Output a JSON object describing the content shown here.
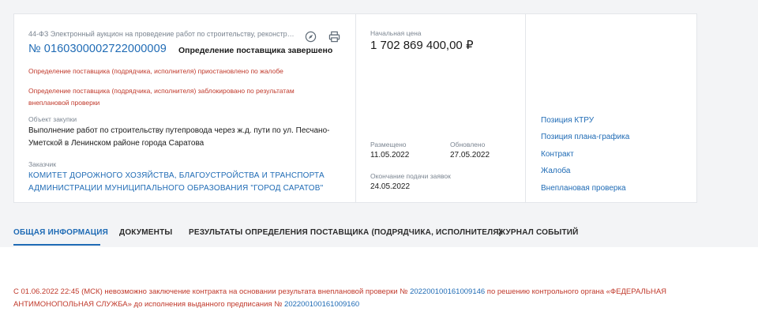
{
  "header": {
    "law_line": "44-ФЗ Электронный аукцион на проведение работ по строительству, реконструкц...",
    "reg_number": "№ 0160300002722000009",
    "stage": "Определение поставщика завершено",
    "alert_1": "Определение поставщика (подрядчика, исполнителя) приостановлено по жалобе",
    "alert_2": "Определение поставщика (подрядчика, исполнителя) заблокировано по результатам внеплановой проверки",
    "object_label": "Объект закупки",
    "object_value": "Выполнение работ по строительству путепровода через ж.д. пути по ул. Песчано-Уметской в Ленинском районе города Саратова",
    "customer_label": "Заказчик",
    "customer_value": "КОМИТЕТ ДОРОЖНОГО ХОЗЯЙСТВА, БЛАГОУСТРОЙСТВА И ТРАНСПОРТА АДМИНИСТРАЦИИ МУНИЦИПАЛЬНОГО ОБРАЗОВАНИЯ \"ГОРОД САРАТОВ\"",
    "icons": [
      "compass-icon",
      "printer-icon"
    ]
  },
  "price": {
    "label": "Начальная цена",
    "value": "1 702 869 400,00 ₽"
  },
  "dates": {
    "posted_label": "Размещено",
    "posted_value": "11.05.2022",
    "updated_label": "Обновлено",
    "updated_value": "27.05.2022",
    "deadline_label": "Окончание подачи заявок",
    "deadline_value": "24.05.2022"
  },
  "side_links": [
    "Позиция КТРУ",
    "Позиция плана-графика",
    "Контракт",
    "Жалоба",
    "Внеплановая проверка"
  ],
  "tabs": [
    "ОБЩАЯ ИНФОРМАЦИЯ",
    "ДОКУМЕНТЫ",
    "РЕЗУЛЬТАТЫ ОПРЕДЕЛЕНИЯ ПОСТАВЩИКА (ПОДРЯДЧИКА, ИСПОЛНИТЕЛЯ)",
    "ЖУРНАЛ СОБЫТИЙ"
  ],
  "notice": {
    "part_1": "С 01.06.2022 22:45 (МСК) невозможно заключение контракта на основании результата внеплановой проверки № ",
    "num_1": "202200100161009146",
    "part_2": " по решению контрольного органа «ФЕДЕРАЛЬНАЯ АНТИМОНОПОЛЬНАЯ СЛУЖБА» до исполнения выданного предписания № ",
    "num_2": "202200100161009160"
  },
  "colors": {
    "accent": "#1f6bb5",
    "alert": "#c0392b",
    "muted": "#7b8591",
    "background": "#f3f4f6"
  }
}
